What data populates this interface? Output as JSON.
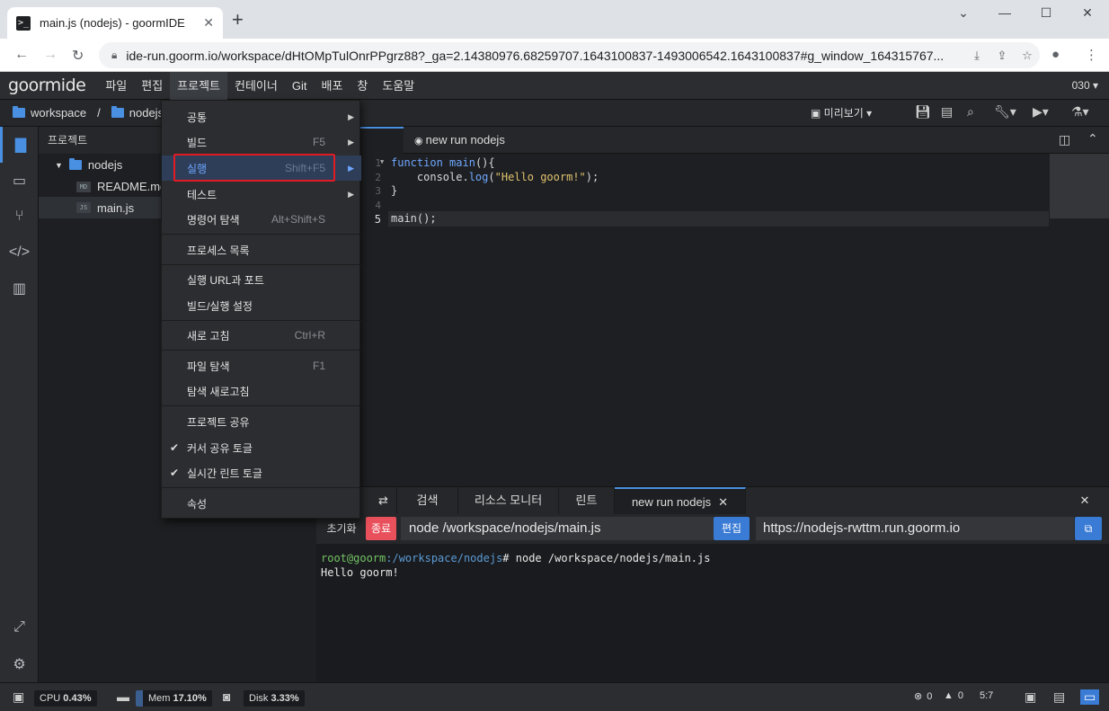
{
  "browser": {
    "tab_title": "main.js (nodejs) - goormIDE",
    "tab_favicon": ">_",
    "new_tab": "+",
    "window_controls": [
      "⌄",
      "—",
      "☐",
      "✕"
    ],
    "url": "ide-run.goorm.io/workspace/dHtOMpTulOnrPPgrz88?_ga=2.14380976.68259707.1643100837-1493006542.1643100837#g_window_164315767..."
  },
  "ide": {
    "logo": "goormide",
    "menu": [
      "파일",
      "편집",
      "프로젝트",
      "컨테이너",
      "Git",
      "배포",
      "창",
      "도움말"
    ],
    "user": "030 ▾",
    "breadcrumb": {
      "root": "workspace",
      "sep": "/",
      "project": "nodejs"
    },
    "preview_label": "미리보기 ▾"
  },
  "explorer": {
    "title": "프로젝트",
    "root": "nodejs",
    "files": [
      {
        "name": "README.md",
        "icon": "MD"
      },
      {
        "name": "main.js",
        "icon": "JS"
      }
    ]
  },
  "editor": {
    "tabs": [
      {
        "label": "main.js *",
        "visible": "n.js *"
      },
      {
        "label": "new run nodejs"
      }
    ],
    "lines": [
      "1",
      "2",
      "3",
      "4",
      "5"
    ]
  },
  "project_menu": {
    "items": [
      {
        "label": "공통",
        "shortcut": ""
      },
      {
        "label": "빌드",
        "shortcut": "F5"
      },
      {
        "label": "실행",
        "shortcut": "Shift+F5"
      },
      {
        "label": "테스트",
        "shortcut": ""
      },
      {
        "label": "명령어 탐색",
        "shortcut": "Alt+Shift+S"
      },
      {
        "label": "프로세스 목록",
        "shortcut": ""
      },
      {
        "label": "실행 URL과 포트",
        "shortcut": ""
      },
      {
        "label": "빌드/실행 설정",
        "shortcut": ""
      },
      {
        "label": "새로 고침",
        "shortcut": "Ctrl+R"
      },
      {
        "label": "파일 탐색",
        "shortcut": "F1"
      },
      {
        "label": "탐색 새로고침",
        "shortcut": ""
      },
      {
        "label": "프로젝트 공유",
        "shortcut": ""
      },
      {
        "label": "커서 공유 토글",
        "shortcut": ""
      },
      {
        "label": "실시간 린트 토글",
        "shortcut": ""
      },
      {
        "label": "속성",
        "shortcut": ""
      }
    ]
  },
  "panel": {
    "tabs": [
      "검색",
      "리소스 모니터",
      "린트",
      "new run nodejs"
    ],
    "reset": "초기화",
    "stop": "종료",
    "command": "node /workspace/nodejs/main.js",
    "edit": "편집",
    "run_url": "https://nodejs-rwttm.run.goorm.io",
    "terminal": {
      "prompt_user": "root@goorm",
      "prompt_path": ":/workspace/nodejs",
      "prompt_cmd": "# node /workspace/nodejs/main.js",
      "output": "Hello goorm!"
    }
  },
  "status": {
    "cpu_label": "CPU",
    "cpu": "0.43%",
    "mem_label": "Mem",
    "mem": "17.10%",
    "disk_label": "Disk",
    "disk": "3.33%",
    "errors": "0",
    "warnings": "0",
    "cursor": "5:7"
  },
  "colors": {
    "accent": "#4a90e2",
    "stop": "#e8505b",
    "highlight_box": "#e01b24"
  }
}
